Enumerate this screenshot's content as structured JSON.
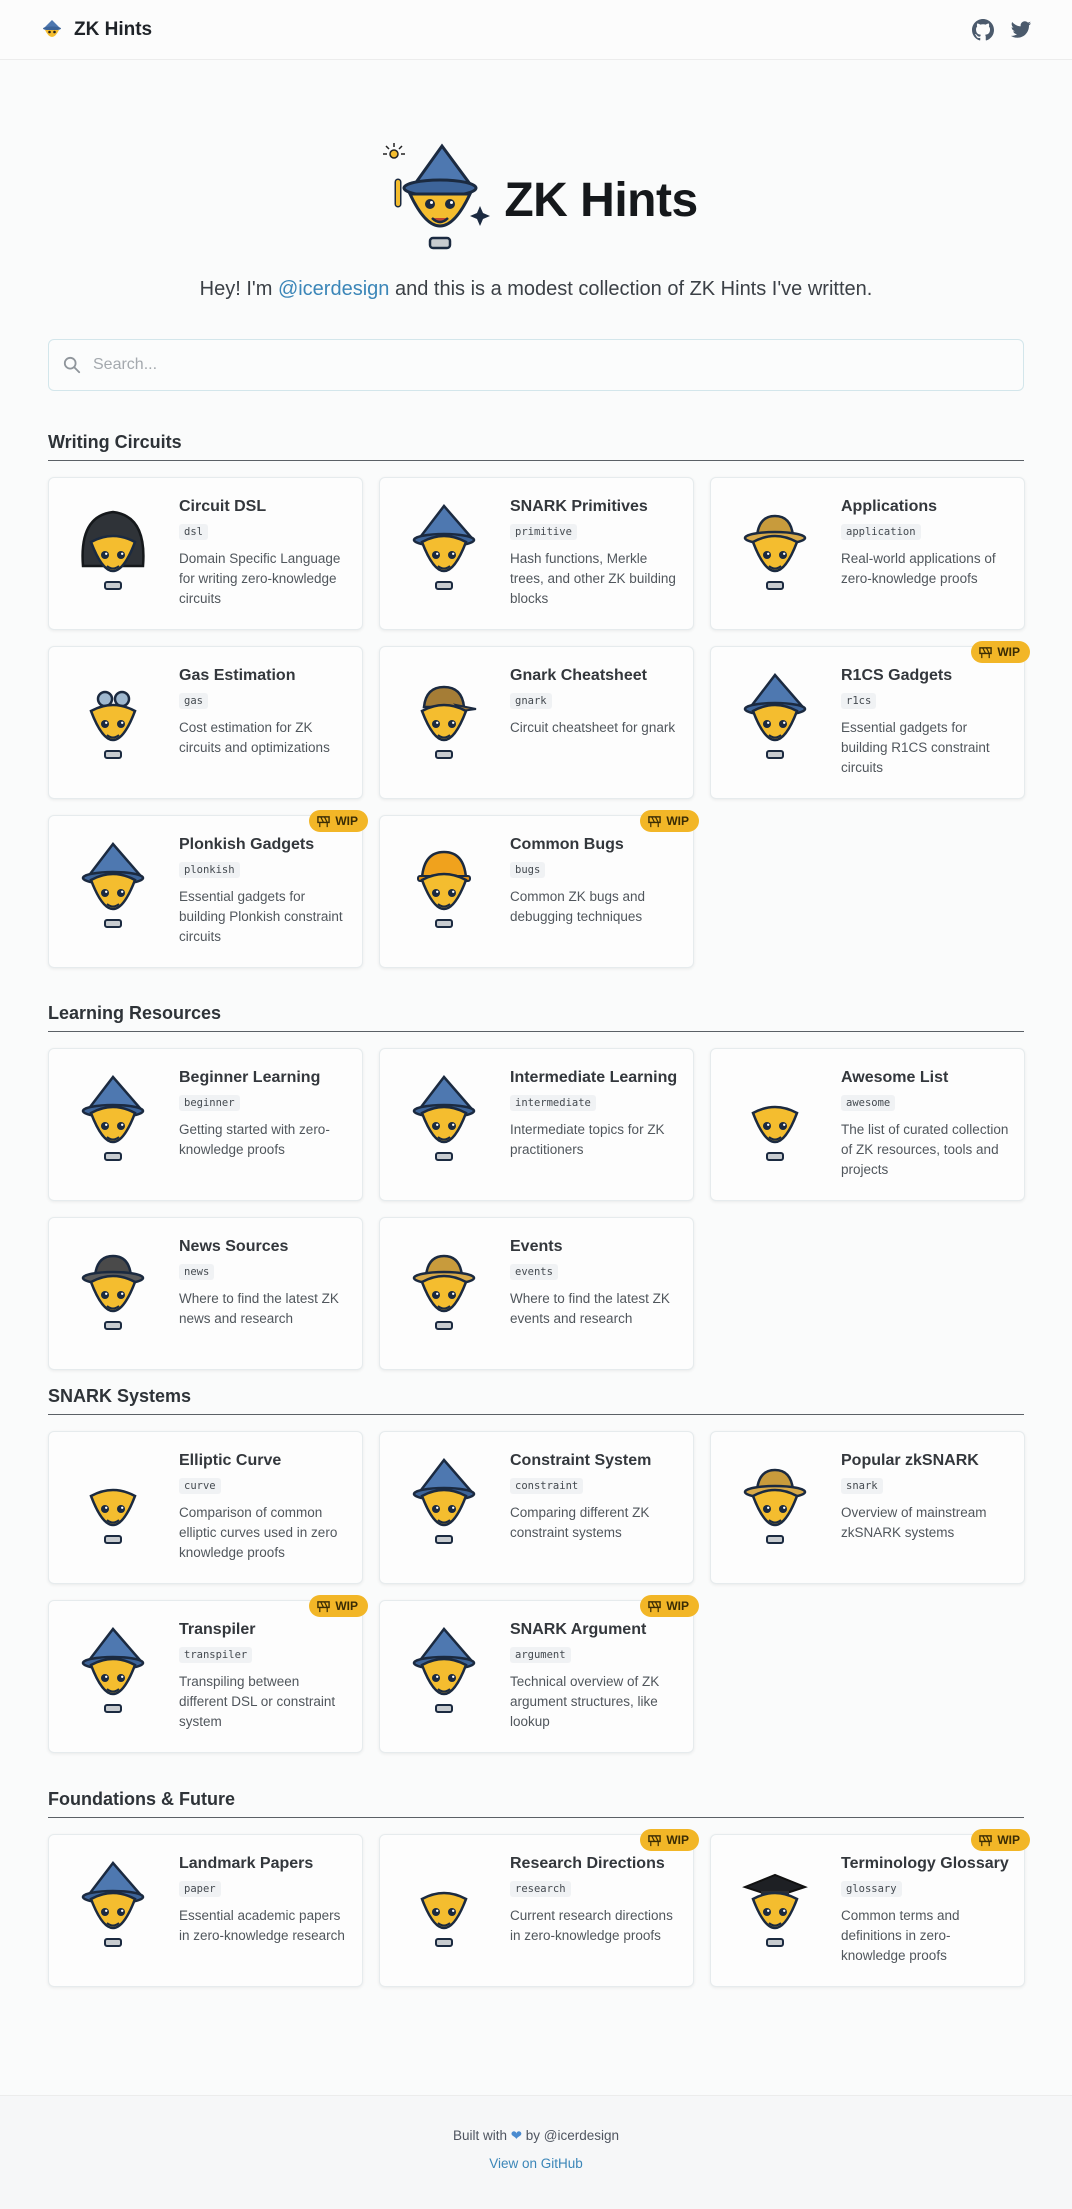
{
  "header": {
    "brand": "ZK Hints",
    "github_icon": "github-icon",
    "twitter_icon": "twitter-icon"
  },
  "hero": {
    "title": "ZK Hints",
    "intro_prefix": "Hey! I'm ",
    "intro_handle": "@icerdesign",
    "intro_suffix": " and this is a modest collection of ZK Hints I've written."
  },
  "search": {
    "placeholder": "Search..."
  },
  "wip_label": "WIP",
  "sections": [
    {
      "title": "Writing Circuits",
      "cards": [
        {
          "title": "Circuit DSL",
          "tag": "dsl",
          "desc": "Domain Specific Language for writing zero-knowledge circuits",
          "wip": false,
          "hat": "hood"
        },
        {
          "title": "SNARK Primitives",
          "tag": "primitive",
          "desc": "Hash functions, Merkle trees, and other ZK building blocks",
          "wip": false,
          "hat": "wizard"
        },
        {
          "title": "Applications",
          "tag": "application",
          "desc": "Real-world applications of zero-knowledge proofs",
          "wip": false,
          "hat": "explorer"
        },
        {
          "title": "Gas Estimation",
          "tag": "gas",
          "desc": "Cost estimation for ZK circuits and optimizations",
          "wip": false,
          "hat": "goggles"
        },
        {
          "title": "Gnark Cheatsheet",
          "tag": "gnark",
          "desc": "Circuit cheatsheet for gnark",
          "wip": false,
          "hat": "cap"
        },
        {
          "title": "R1CS Gadgets",
          "tag": "r1cs",
          "desc": "Essential gadgets for building R1CS constraint circuits",
          "wip": true,
          "hat": "wizard"
        },
        {
          "title": "Plonkish Gadgets",
          "tag": "plonkish",
          "desc": "Essential gadgets for building Plonkish constraint circuits",
          "wip": true,
          "hat": "wizard"
        },
        {
          "title": "Common Bugs",
          "tag": "bugs",
          "desc": "Common ZK bugs and debugging techniques",
          "wip": true,
          "hat": "helmet"
        }
      ]
    },
    {
      "title": "Learning Resources",
      "cards": [
        {
          "title": "Beginner Learning",
          "tag": "beginner",
          "desc": "Getting started with zero-knowledge proofs",
          "wip": false,
          "hat": "wizard"
        },
        {
          "title": "Intermediate Learning",
          "tag": "intermediate",
          "desc": "Intermediate topics for ZK practitioners",
          "wip": false,
          "hat": "wizard"
        },
        {
          "title": "Awesome List",
          "tag": "awesome",
          "desc": "The list of curated collection of ZK resources, tools and projects",
          "wip": false,
          "hat": "none"
        },
        {
          "title": "News Sources",
          "tag": "news",
          "desc": "Where to find the latest ZK news and research",
          "wip": false,
          "hat": "fedora"
        },
        {
          "title": "Events",
          "tag": "events",
          "desc": "Where to find the latest ZK events and research",
          "wip": false,
          "hat": "explorer"
        }
      ]
    },
    {
      "title": "SNARK Systems",
      "cards": [
        {
          "title": "Elliptic Curve",
          "tag": "curve",
          "desc": "Comparison of common elliptic curves used in zero knowledge proofs",
          "wip": false,
          "hat": "none"
        },
        {
          "title": "Constraint System",
          "tag": "constraint",
          "desc": "Comparing different ZK constraint systems",
          "wip": false,
          "hat": "wizard"
        },
        {
          "title": "Popular zkSNARK",
          "tag": "snark",
          "desc": "Overview of mainstream zkSNARK systems",
          "wip": false,
          "hat": "explorer"
        },
        {
          "title": "Transpiler",
          "tag": "transpiler",
          "desc": "Transpiling between different DSL or constraint system",
          "wip": true,
          "hat": "wizard"
        },
        {
          "title": "SNARK Argument",
          "tag": "argument",
          "desc": "Technical overview of ZK argument structures, like lookup",
          "wip": true,
          "hat": "wizard"
        }
      ]
    },
    {
      "title": "Foundations & Future",
      "cards": [
        {
          "title": "Landmark Papers",
          "tag": "paper",
          "desc": "Essential academic papers in zero-knowledge research",
          "wip": false,
          "hat": "wizard"
        },
        {
          "title": "Research Directions",
          "tag": "research",
          "desc": "Current research directions in zero-knowledge proofs",
          "wip": true,
          "hat": "none"
        },
        {
          "title": "Terminology Glossary",
          "tag": "glossary",
          "desc": "Common terms and definitions in zero-knowledge proofs",
          "wip": true,
          "hat": "gradcap"
        }
      ]
    }
  ],
  "footer": {
    "built_prefix": "Built with ",
    "built_suffix": " by @icerdesign",
    "link": "View on GitHub"
  },
  "colors": {
    "accent": "#f2b627",
    "link": "#3b86b8",
    "hat_blue": "#4e78b0"
  }
}
